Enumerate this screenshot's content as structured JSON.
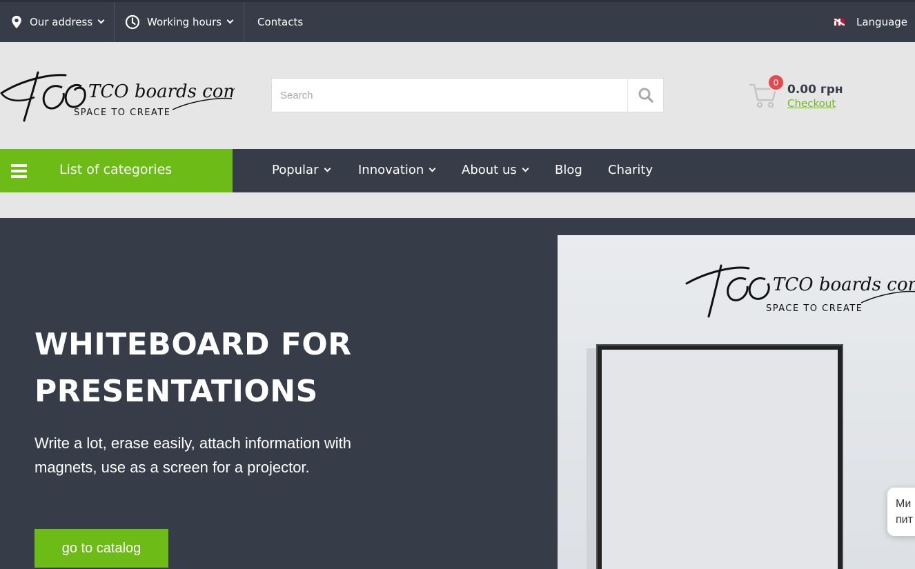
{
  "topbar": {
    "address_label": "Our address",
    "hours_label": "Working hours",
    "contacts_label": "Contacts",
    "language_label": "Language"
  },
  "header": {
    "logo_text": "TCO boards company",
    "logo_tagline": "SPACE TO CREATE",
    "search_placeholder": "Search",
    "cart": {
      "count": "0",
      "total": "0.00 грн",
      "checkout_label": "Checkout"
    }
  },
  "nav": {
    "categories_label": "List of categories",
    "items": [
      {
        "label": "Popular",
        "has_dropdown": true
      },
      {
        "label": "Innovation",
        "has_dropdown": true
      },
      {
        "label": "About us",
        "has_dropdown": true
      },
      {
        "label": "Blog",
        "has_dropdown": false
      },
      {
        "label": "Charity",
        "has_dropdown": false
      }
    ]
  },
  "hero": {
    "title_line1": "WHITEBOARD FOR",
    "title_line2": "PRESENTATIONS",
    "text": "Write a lot, erase easily, attach information with magnets, use as a screen for a projector.",
    "button_label": "go to catalog"
  },
  "chat": {
    "line1": "Ми",
    "line2": "пит"
  },
  "colors": {
    "dark": "#363c48",
    "accent_green": "#6cbb16",
    "badge_red": "#e5484d",
    "background": "#e6e6e6"
  },
  "icons": [
    "map-pin-icon",
    "clock-icon",
    "uk-flag-icon",
    "search-icon",
    "cart-icon",
    "hamburger-icon",
    "chevron-down-icon"
  ]
}
